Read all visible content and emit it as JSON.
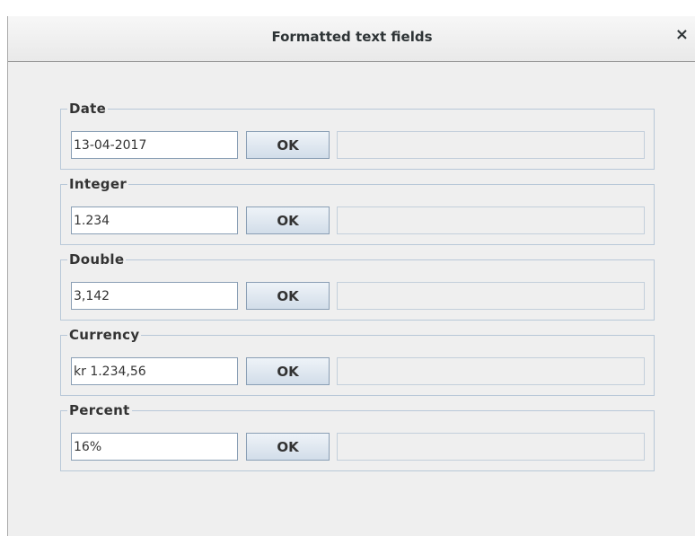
{
  "window": {
    "title": "Formatted text fields",
    "close_glyph": "×"
  },
  "groups": [
    {
      "label": "Date",
      "value": "13-04-2017",
      "button": "OK",
      "result": ""
    },
    {
      "label": "Integer",
      "value": "1.234",
      "button": "OK",
      "result": ""
    },
    {
      "label": "Double",
      "value": "3,142",
      "button": "OK",
      "result": ""
    },
    {
      "label": "Currency",
      "value": "kr 1.234,56",
      "button": "OK",
      "result": ""
    },
    {
      "label": "Percent",
      "value": "16%",
      "button": "OK",
      "result": ""
    }
  ]
}
